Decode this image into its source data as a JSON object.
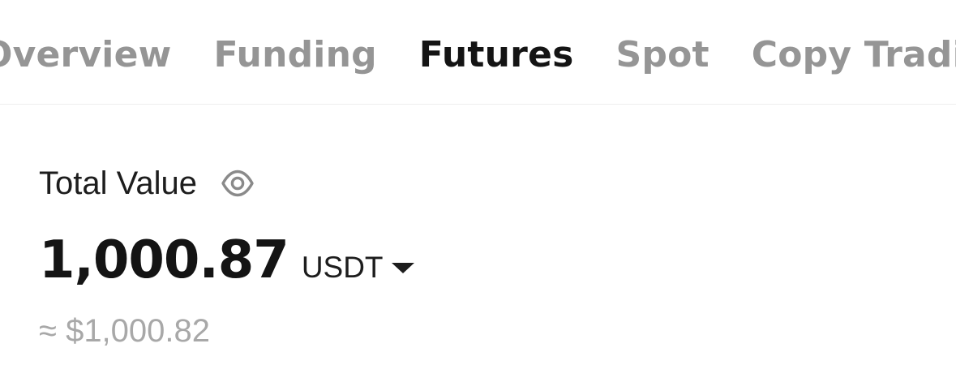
{
  "tabs": [
    {
      "label": "Overview",
      "active": false
    },
    {
      "label": "Funding",
      "active": false
    },
    {
      "label": "Futures",
      "active": true
    },
    {
      "label": "Spot",
      "active": false
    },
    {
      "label": "Copy Trading",
      "active": false
    }
  ],
  "summary": {
    "title": "Total Value",
    "visibility_icon": "eye-icon",
    "amount": "1,000.87",
    "currency": "USDT",
    "currency_dropdown_icon": "caret-down-icon",
    "approx_value": "≈ $1,000.82"
  },
  "colors": {
    "active_tab": "#141414",
    "inactive_tab": "#959595",
    "secondary_text": "#a8a8a8"
  }
}
